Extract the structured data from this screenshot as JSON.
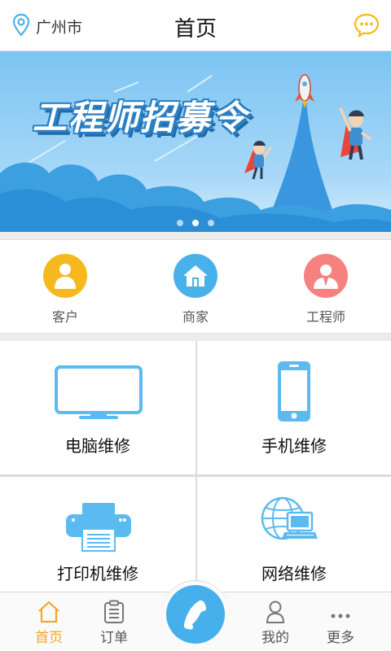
{
  "header": {
    "location": "广州市",
    "title": "首页",
    "location_icon": "map-pin-icon",
    "message_icon": "chat-bubble-icon"
  },
  "banner": {
    "title": "工程师招募令",
    "slides": 3,
    "active_slide": 2
  },
  "roles": [
    {
      "label": "客户",
      "icon": "customer-icon",
      "color": "#f6b91d"
    },
    {
      "label": "商家",
      "icon": "shop-icon",
      "color": "#49b1ea"
    },
    {
      "label": "工程师",
      "icon": "engineer-icon",
      "color": "#f5827f"
    }
  ],
  "services": [
    {
      "label": "电脑维修",
      "icon": "monitor-icon"
    },
    {
      "label": "手机维修",
      "icon": "phone-icon"
    },
    {
      "label": "打印机维修",
      "icon": "printer-icon"
    },
    {
      "label": "网络维修",
      "icon": "network-icon"
    }
  ],
  "bottom_nav": {
    "tabs": [
      {
        "label": "首页",
        "icon": "home-icon",
        "active": true
      },
      {
        "label": "订单",
        "icon": "clipboard-icon",
        "active": false
      },
      {
        "label": "我的",
        "icon": "user-icon",
        "active": false
      },
      {
        "label": "更多",
        "icon": "more-icon",
        "active": false
      }
    ],
    "call_icon": "telephone-icon"
  },
  "colors": {
    "accent": "#f5a623",
    "primary_blue": "#45b0ec",
    "icon_blue": "#5bbbf0"
  }
}
